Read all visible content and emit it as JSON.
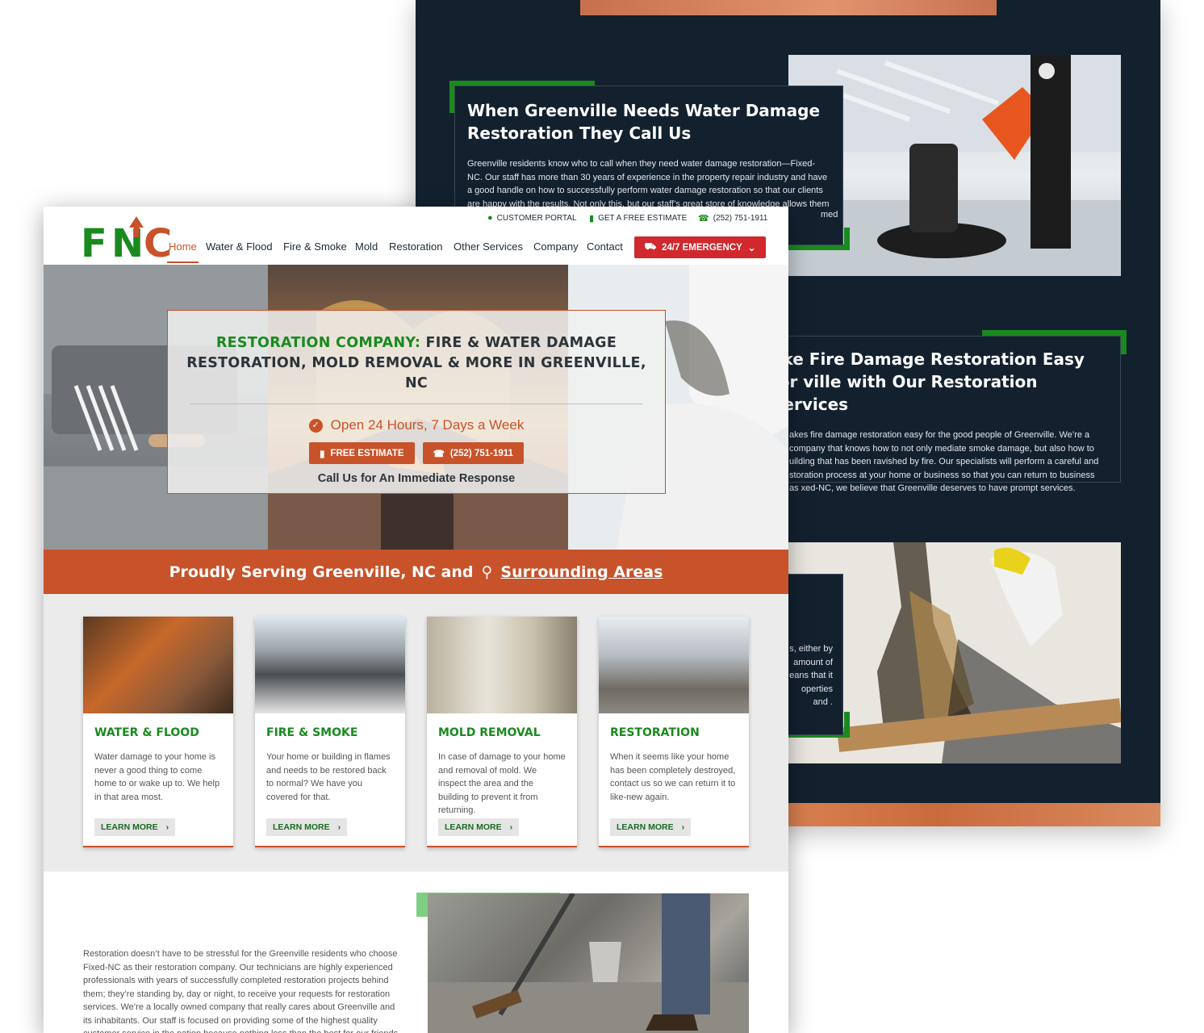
{
  "back_page": {
    "section1": {
      "heading": "When Greenville Needs Water Damage Restoration They Call Us",
      "body": "Greenville residents know who to call when they need water damage restoration—Fixed-NC. Our staff has more than 30 years of experience in the property repair industry and have a good handle on how to successfully perform water damage restoration so that our clients are happy with the results. Not only this, but our staff’s great store of knowledge allows them to see small",
      "body_tail": "med"
    },
    "section2": {
      "heading": "ake Fire Damage Restoration Easy for ville with Our Restoration Services",
      "body": "akes fire damage restoration easy for the good people of Greenville. We’re a company that knows how to not only mediate smoke damage, but also how to uilding that has been ravished by fire. Our specialists will perform a careful and storation process at your home or business so that you can return to business as xed-NC, we believe that Greenville deserves to have prompt services."
    },
    "section3": {
      "body": "s, either by amount of eans that it operties and ."
    }
  },
  "utility": {
    "portal": "CUSTOMER PORTAL",
    "estimate": "GET A FREE ESTIMATE",
    "phone": "(252) 751-1911"
  },
  "logo": {
    "f": "F",
    "n": "N",
    "c": "C"
  },
  "nav": {
    "items": [
      "Home",
      "Water & Flood",
      "Fire & Smoke",
      "Mold",
      "Restoration",
      "Other Services",
      "Company",
      "Contact"
    ],
    "emergency": "24/7 EMERGENCY"
  },
  "hero": {
    "title_green": "RESTORATION COMPANY:",
    "title_rest": " FIRE & WATER DAMAGE RESTORATION, MOLD REMOVAL & MORE IN GREENVILLE, NC",
    "hours": "Open 24 Hours, 7 Days a Week",
    "btn_estimate": "FREE ESTIMATE",
    "btn_phone": "(252) 751-1911",
    "call": "Call Us for An Immediate Response"
  },
  "serving": {
    "text": "Proudly Serving Greenville, NC and",
    "link": "Surrounding Areas"
  },
  "services": [
    {
      "title": "WATER & FLOOD",
      "text": "Water damage to your home is never a good thing to come home to or wake up to. We help in that area most.",
      "more": "LEARN MORE"
    },
    {
      "title": "FIRE & SMOKE",
      "text": "Your home or building in flames and needs to be restored back to normal? We have you covered for that.",
      "more": "LEARN MORE"
    },
    {
      "title": "MOLD REMOVAL",
      "text": "In case of damage to your home and removal of mold. We inspect the area and the building to prevent it from returning.",
      "more": "LEARN MORE"
    },
    {
      "title": "RESTORATION",
      "text": "When it seems like your home has been completely destroyed, contact us so we can return it to like-new again.",
      "more": "LEARN MORE"
    }
  ],
  "about": {
    "text": "Restoration doesn’t have to be stressful for the Greenville residents who choose Fixed-NC as their restoration company. Our technicians are highly experienced professionals with years of successfully completed restoration projects behind them; they’re standing by, day or night, to receive your requests for restoration services. We’re a locally owned company that really cares about Greenville and its inhabitants. Our staff is focused on providing some of the highest quality customer service in the nation because nothing less than the best for our friends and"
  },
  "colors": {
    "green": "#1a8a1f",
    "orange": "#c8522a",
    "navy": "#13212f",
    "red": "#d0282d"
  }
}
